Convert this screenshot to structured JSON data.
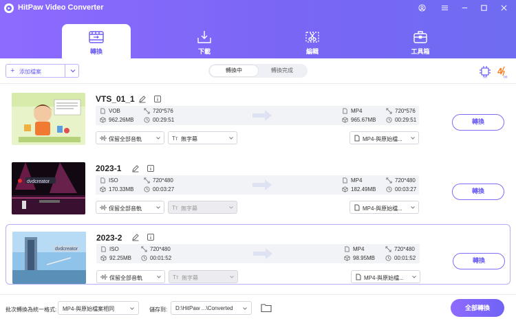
{
  "app": {
    "title": "HitPaw Video Converter"
  },
  "nav": {
    "tabs": [
      {
        "label": "轉換"
      },
      {
        "label": "下載"
      },
      {
        "label": "編輯"
      },
      {
        "label": "工具箱"
      }
    ]
  },
  "toolbar": {
    "add_label": "添加檔案",
    "seg_converting": "轉換中",
    "seg_done": "轉換完成"
  },
  "files": [
    {
      "name": "VTS_01_1",
      "src": {
        "format": "VOB",
        "resolution": "720*576",
        "size": "962.26MB",
        "duration": "00:29:51"
      },
      "dst": {
        "format": "MP4",
        "resolution": "720*576",
        "size": "965.67MB",
        "duration": "00:29:51"
      },
      "audio": "保留全部音軌",
      "subtitle": "無字幕",
      "subtitle_enabled": true,
      "output_format": "MP4-與原始檔...",
      "button": "轉換"
    },
    {
      "name": "2023-1",
      "src": {
        "format": "ISO",
        "resolution": "720*480",
        "size": "170.33MB",
        "duration": "00:03:27"
      },
      "dst": {
        "format": "MP4",
        "resolution": "720*480",
        "size": "182.49MB",
        "duration": "00:03:27"
      },
      "audio": "保留全部音軌",
      "subtitle": "無字幕",
      "subtitle_enabled": false,
      "output_format": "MP4-與原始檔...",
      "button": "轉換"
    },
    {
      "name": "2023-2",
      "src": {
        "format": "ISO",
        "resolution": "720*480",
        "size": "92.25MB",
        "duration": "00:01:52"
      },
      "dst": {
        "format": "MP4",
        "resolution": "720*480",
        "size": "98.95MB",
        "duration": "00:01:52"
      },
      "audio": "保留全部音軌",
      "subtitle": "無字幕",
      "subtitle_enabled": false,
      "output_format": "MP4-與原始檔...",
      "button": "轉換"
    }
  ],
  "footer": {
    "batch_label": "批次轉換為統一格式:",
    "batch_value": "MP4-與原始檔案相同",
    "save_label": "儲存到:",
    "save_path": "D:\\HitPaw ...\\Converted",
    "convert_all": "全部轉換"
  },
  "colors": {
    "accent": "#7a66f5",
    "header_start": "#8d6bff",
    "header_end": "#6f6cf2"
  }
}
